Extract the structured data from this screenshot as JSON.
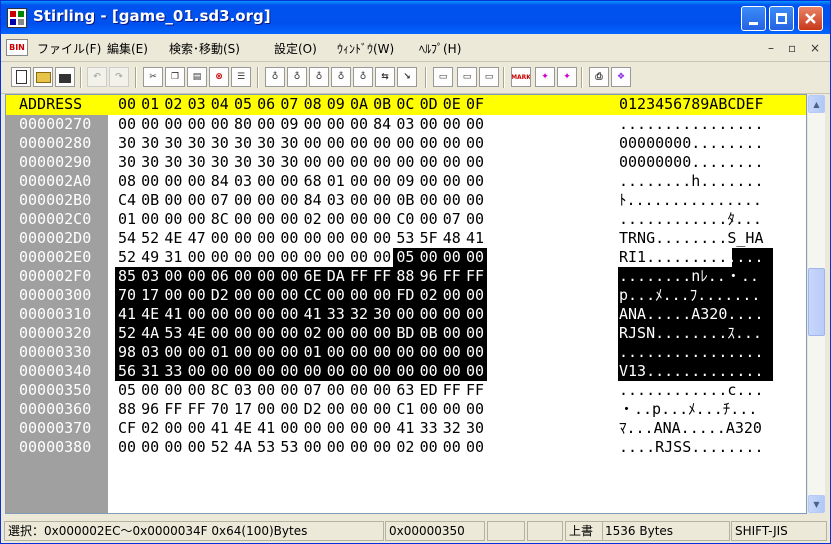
{
  "window": {
    "title": "Stirling - [game_01.sd3.org]",
    "minimize_icon": "minimize-icon",
    "maximize_icon": "maximize-icon",
    "close_icon": "close-icon"
  },
  "menubar": {
    "items": [
      "ファイル(F)",
      "編集(E)",
      "検索･移動(S)",
      "設定(O)",
      "ｳｨﾝﾄﾞｳ(W)",
      "ﾍﾙﾌﾟ(H)"
    ],
    "mdi_minimize": "–",
    "mdi_restore": "▫",
    "mdi_close": "×"
  },
  "toolbar": {
    "icons": [
      "new-file-icon",
      "open-folder-icon",
      "save-icon",
      "undo-icon",
      "redo-icon",
      "cut-icon",
      "copy-icon",
      "paste-icon",
      "delete-icon",
      "paste-insert-icon",
      "find-icon",
      "find-hex-icon",
      "find-next-icon",
      "find-prev-icon",
      "replace-icon",
      "compare-icon",
      "jump-icon",
      "new-window-icon",
      "cascade-icon",
      "tile-icon",
      "mark-icon",
      "mark-next-icon",
      "mark-prev-icon",
      "print-icon",
      "help-book-icon"
    ],
    "mark_label": "MARK"
  },
  "hex": {
    "header_label": "ADDRESS",
    "header_cols": [
      "00",
      "01",
      "02",
      "03",
      "04",
      "05",
      "06",
      "07",
      "08",
      "09",
      "0A",
      "0B",
      "0C",
      "0D",
      "0E",
      "0F"
    ],
    "header_ascii": "0123456789ABCDEF",
    "rows": [
      {
        "addr": "00000270",
        "bytes": [
          "00",
          "00",
          "00",
          "00",
          "00",
          "80",
          "00",
          "09",
          "00",
          "00",
          "00",
          "84",
          "03",
          "00",
          "00",
          "00"
        ],
        "ascii": "................"
      },
      {
        "addr": "00000280",
        "bytes": [
          "30",
          "30",
          "30",
          "30",
          "30",
          "30",
          "30",
          "30",
          "00",
          "00",
          "00",
          "00",
          "00",
          "00",
          "00",
          "00"
        ],
        "ascii": "00000000........"
      },
      {
        "addr": "00000290",
        "bytes": [
          "30",
          "30",
          "30",
          "30",
          "30",
          "30",
          "30",
          "30",
          "00",
          "00",
          "00",
          "00",
          "00",
          "00",
          "00",
          "00"
        ],
        "ascii": "00000000........"
      },
      {
        "addr": "000002A0",
        "bytes": [
          "08",
          "00",
          "00",
          "00",
          "84",
          "03",
          "00",
          "00",
          "68",
          "01",
          "00",
          "00",
          "09",
          "00",
          "00",
          "00"
        ],
        "ascii": "........h......."
      },
      {
        "addr": "000002B0",
        "bytes": [
          "C4",
          "0B",
          "00",
          "00",
          "07",
          "00",
          "00",
          "00",
          "84",
          "03",
          "00",
          "00",
          "0B",
          "00",
          "00",
          "00"
        ],
        "ascii": "ﾄ..............."
      },
      {
        "addr": "000002C0",
        "bytes": [
          "01",
          "00",
          "00",
          "00",
          "8C",
          "00",
          "00",
          "00",
          "02",
          "00",
          "00",
          "00",
          "C0",
          "00",
          "07",
          "00"
        ],
        "ascii": "............ﾀ..."
      },
      {
        "addr": "000002D0",
        "bytes": [
          "54",
          "52",
          "4E",
          "47",
          "00",
          "00",
          "00",
          "00",
          "00",
          "00",
          "00",
          "00",
          "53",
          "5F",
          "48",
          "41"
        ],
        "ascii": "TRNG........S_HA"
      },
      {
        "addr": "000002E0",
        "bytes": [
          "52",
          "49",
          "31",
          "00",
          "00",
          "00",
          "00",
          "00",
          "00",
          "00",
          "00",
          "00",
          "05",
          "00",
          "00",
          "00"
        ],
        "ascii": "RI1............."
      },
      {
        "addr": "000002F0",
        "bytes": [
          "85",
          "03",
          "00",
          "00",
          "06",
          "00",
          "00",
          "00",
          "6E",
          "DA",
          "FF",
          "FF",
          "88",
          "96",
          "FF",
          "FF"
        ],
        "ascii": "........nﾚ..・.."
      },
      {
        "addr": "00000300",
        "bytes": [
          "70",
          "17",
          "00",
          "00",
          "D2",
          "00",
          "00",
          "00",
          "CC",
          "00",
          "00",
          "00",
          "FD",
          "02",
          "00",
          "00"
        ],
        "ascii": "p...ﾒ...ﾌ......."
      },
      {
        "addr": "00000310",
        "bytes": [
          "41",
          "4E",
          "41",
          "00",
          "00",
          "00",
          "00",
          "00",
          "41",
          "33",
          "32",
          "30",
          "00",
          "00",
          "00",
          "00"
        ],
        "ascii": "ANA.....A320...."
      },
      {
        "addr": "00000320",
        "bytes": [
          "52",
          "4A",
          "53",
          "4E",
          "00",
          "00",
          "00",
          "00",
          "02",
          "00",
          "00",
          "00",
          "BD",
          "0B",
          "00",
          "00"
        ],
        "ascii": "RJSN........ｽ..."
      },
      {
        "addr": "00000330",
        "bytes": [
          "98",
          "03",
          "00",
          "00",
          "01",
          "00",
          "00",
          "00",
          "01",
          "00",
          "00",
          "00",
          "00",
          "00",
          "00",
          "00"
        ],
        "ascii": "................"
      },
      {
        "addr": "00000340",
        "bytes": [
          "56",
          "31",
          "33",
          "00",
          "00",
          "00",
          "00",
          "00",
          "00",
          "00",
          "00",
          "00",
          "00",
          "00",
          "00",
          "00"
        ],
        "ascii": "V13............."
      },
      {
        "addr": "00000350",
        "bytes": [
          "05",
          "00",
          "00",
          "00",
          "8C",
          "03",
          "00",
          "00",
          "07",
          "00",
          "00",
          "00",
          "63",
          "ED",
          "FF",
          "FF"
        ],
        "ascii": "............c..."
      },
      {
        "addr": "00000360",
        "bytes": [
          "88",
          "96",
          "FF",
          "FF",
          "70",
          "17",
          "00",
          "00",
          "D2",
          "00",
          "00",
          "00",
          "C1",
          "00",
          "00",
          "00"
        ],
        "ascii": "・..p...ﾒ...ﾁ..."
      },
      {
        "addr": "00000370",
        "bytes": [
          "CF",
          "02",
          "00",
          "00",
          "41",
          "4E",
          "41",
          "00",
          "00",
          "00",
          "00",
          "00",
          "41",
          "33",
          "32",
          "30"
        ],
        "ascii": "ﾏ...ANA.....A320"
      },
      {
        "addr": "00000380",
        "bytes": [
          "00",
          "00",
          "00",
          "00",
          "52",
          "4A",
          "53",
          "53",
          "00",
          "00",
          "00",
          "00",
          "02",
          "00",
          "00",
          "00"
        ],
        "ascii": "....RJSS........"
      }
    ]
  },
  "statusbar": {
    "selection": "選択：0x000002EC～0x0000034F  0x64(100)Bytes",
    "cursor": "0x00000350",
    "mode": "上書",
    "size": "1536 Bytes",
    "encoding": "SHIFT-JIS"
  },
  "colors": {
    "header_bg": "#FFFF00",
    "address_bg": "#A0A0A0",
    "selection_bg": "#000000",
    "titlebar": "#0054E3"
  }
}
